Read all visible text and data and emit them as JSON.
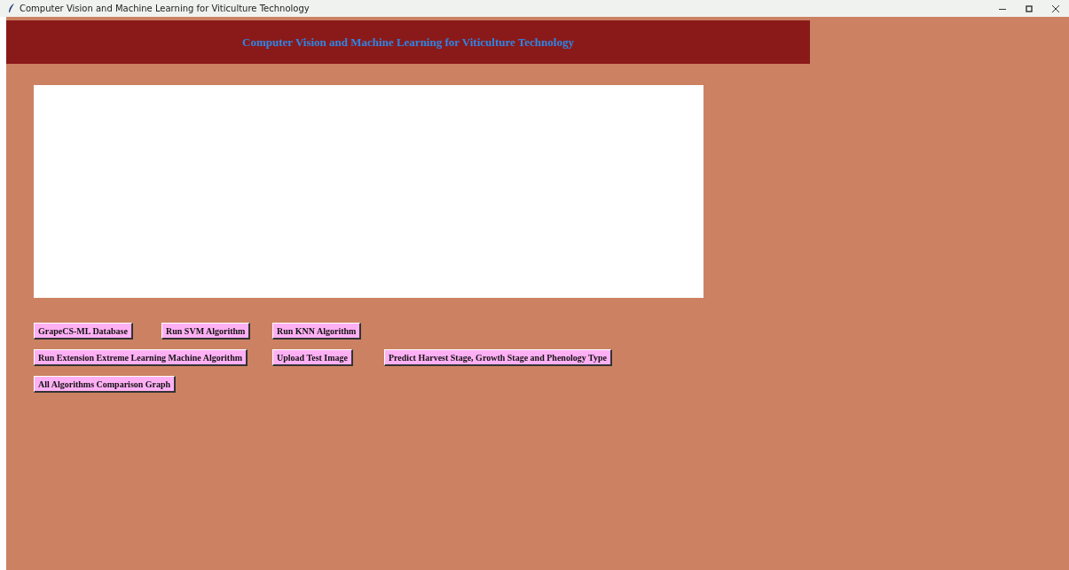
{
  "window": {
    "title": "Computer Vision and Machine Learning for Viticulture Technology"
  },
  "header": {
    "title": "Computer Vision and Machine Learning for Viticulture Technology"
  },
  "button_rows": [
    [
      "GrapeCS-ML Database",
      "Run SVM Algorithm",
      "Run KNN Algorithm"
    ],
    [
      "Run Extension Extreme Learning Machine Algorithm",
      "Upload Test Image",
      "Predict Harvest Stage, Growth Stage and Phenology Type"
    ],
    [
      "All Algorithms Comparison Graph"
    ]
  ]
}
